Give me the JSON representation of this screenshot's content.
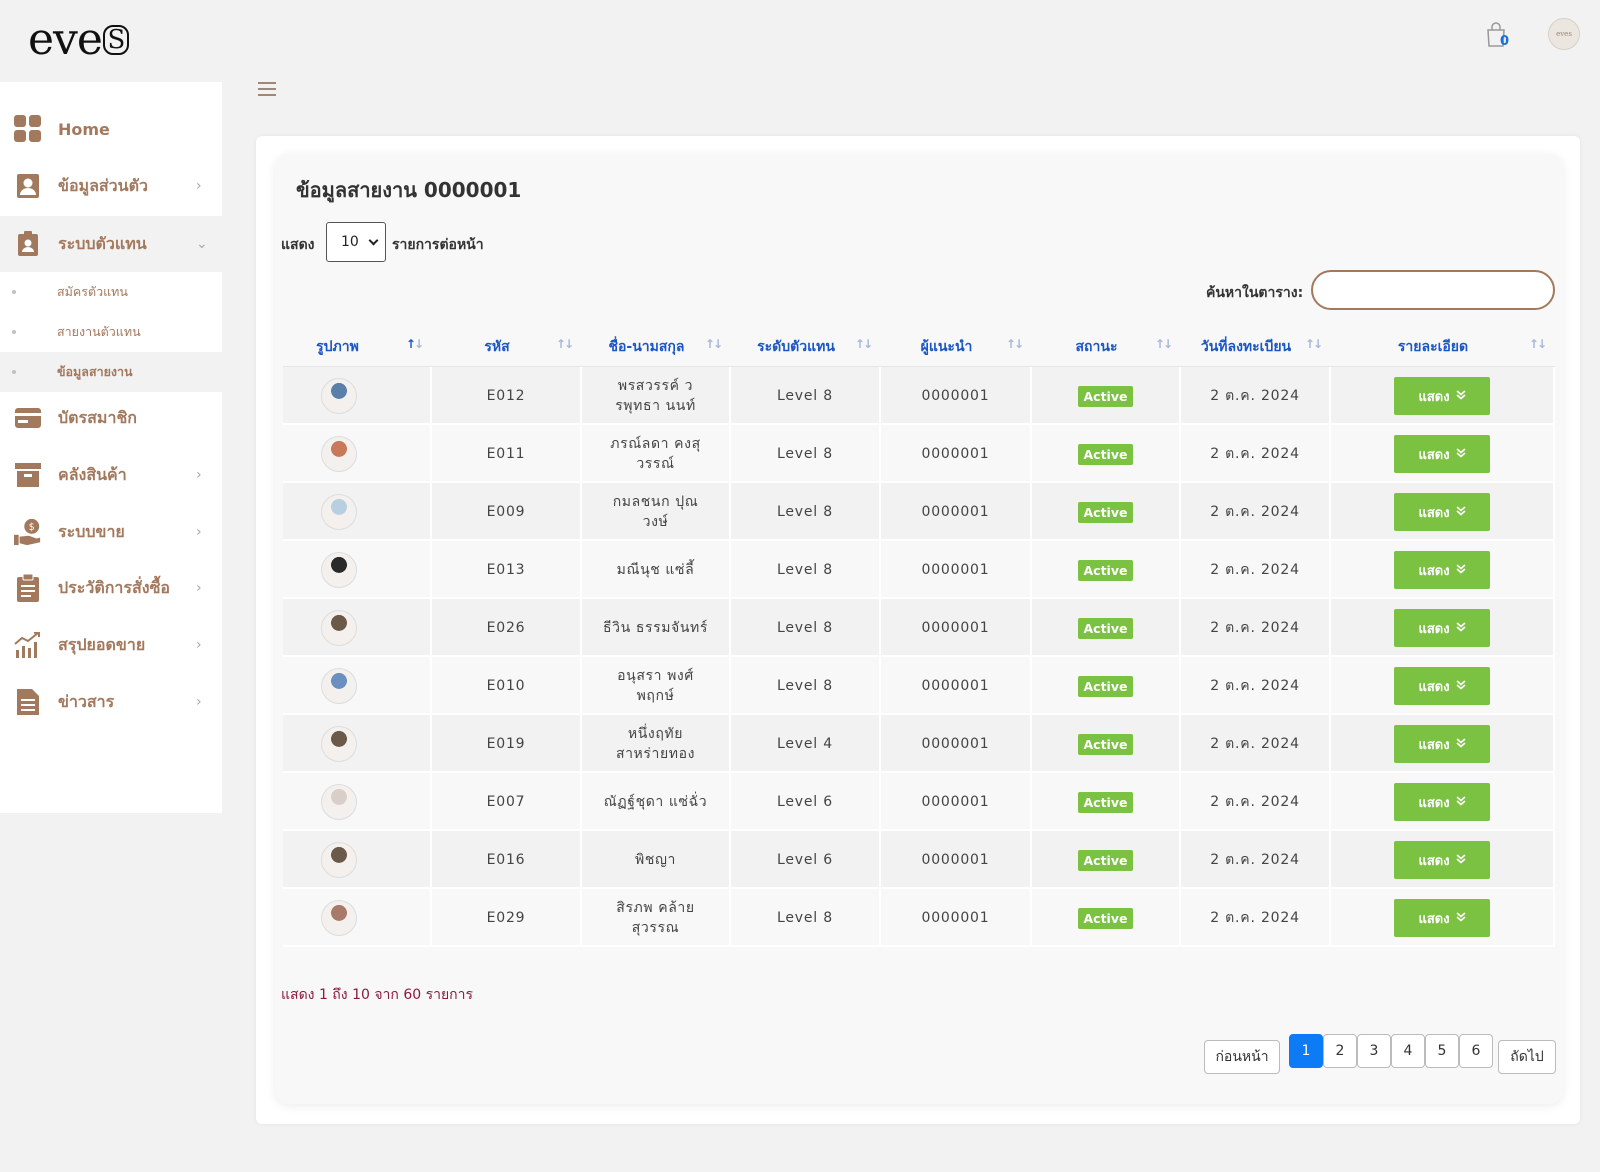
{
  "brand": {
    "logo_text": "eve",
    "logo_s": "S"
  },
  "header": {
    "cart_count": "0",
    "avatar_text": "eves"
  },
  "sidebar": {
    "items": [
      {
        "label": "Home",
        "icon": "grid-icon"
      },
      {
        "label": "ข้อมูลส่วนตัว",
        "icon": "user-icon",
        "chevron": "›"
      },
      {
        "label": "ระบบตัวแทน",
        "icon": "id-badge-icon",
        "chevron": "⌄"
      },
      {
        "label": "บัตรสมาชิก",
        "icon": "card-icon"
      },
      {
        "label": "คลังสินค้า",
        "icon": "warehouse-icon",
        "chevron": "›"
      },
      {
        "label": "ระบบขาย",
        "icon": "sales-icon",
        "chevron": "›"
      },
      {
        "label": "ประวัติการสั่งซื้อ",
        "icon": "clipboard-icon",
        "chevron": "›"
      },
      {
        "label": "สรุปยอดขาย",
        "icon": "chart-icon",
        "chevron": "›"
      },
      {
        "label": "ข่าวสาร",
        "icon": "news-icon",
        "chevron": "›"
      }
    ],
    "sub_items": [
      {
        "label": "สมัครตัวแทน"
      },
      {
        "label": "สายงานตัวแทน"
      },
      {
        "label": "ข้อมูลสายงาน"
      }
    ]
  },
  "main": {
    "title": "ข้อมูลสายงาน 0000001",
    "length_prefix": "แสดง",
    "length_value": "10",
    "length_suffix": "รายการต่อหน้า",
    "search_label": "ค้นหาในตาราง:",
    "search_value": ""
  },
  "table": {
    "columns": [
      "รูปภาพ",
      "รหัส",
      "ชื่อ-นามสกุล",
      "ระดับตัวแทน",
      "ผู้แนะนำ",
      "สถานะ",
      "วันที่ลงทะเบียน",
      "รายละเอียด"
    ],
    "rows": [
      {
        "code": "E012",
        "name": "พรสวรรค์ วรพุทธา นนท์",
        "level": "Level 8",
        "ref": "0000001",
        "status": "Active",
        "date": "2 ต.ค. 2024",
        "action": "แสดง",
        "avatar_color": "#5a7fa8"
      },
      {
        "code": "E011",
        "name": "ภรณ์ลดา คงสุวรรณ์",
        "level": "Level 8",
        "ref": "0000001",
        "status": "Active",
        "date": "2 ต.ค. 2024",
        "action": "แสดง",
        "avatar_color": "#c9795a"
      },
      {
        "code": "E009",
        "name": "กมลชนก ปุณวงษ์",
        "level": "Level 8",
        "ref": "0000001",
        "status": "Active",
        "date": "2 ต.ค. 2024",
        "action": "แสดง",
        "avatar_color": "#b8cfe0"
      },
      {
        "code": "E013",
        "name": "มณีนุช แซ่ลี้",
        "level": "Level 8",
        "ref": "0000001",
        "status": "Active",
        "date": "2 ต.ค. 2024",
        "action": "แสดง",
        "avatar_color": "#2a2a2a"
      },
      {
        "code": "E026",
        "name": "ธีวิน ธรรมจันทร์",
        "level": "Level 8",
        "ref": "0000001",
        "status": "Active",
        "date": "2 ต.ค. 2024",
        "action": "แสดง",
        "avatar_color": "#6b5a4a"
      },
      {
        "code": "E010",
        "name": "อนุสรา พงศ์พฤกษ์",
        "level": "Level 8",
        "ref": "0000001",
        "status": "Active",
        "date": "2 ต.ค. 2024",
        "action": "แสดง",
        "avatar_color": "#6a8fc0"
      },
      {
        "code": "E019",
        "name": "หนึ่งฤทัย สาหร่ายทอง",
        "level": "Level 4",
        "ref": "0000001",
        "status": "Active",
        "date": "2 ต.ค. 2024",
        "action": "แสดง",
        "avatar_color": "#6b5a4a"
      },
      {
        "code": "E007",
        "name": "ณัฏฐ์ชุดา แซ่ฉั่ว",
        "level": "Level 6",
        "ref": "0000001",
        "status": "Active",
        "date": "2 ต.ค. 2024",
        "action": "แสดง",
        "avatar_color": "#d9cfc8"
      },
      {
        "code": "E016",
        "name": "พิชญา",
        "level": "Level 6",
        "ref": "0000001",
        "status": "Active",
        "date": "2 ต.ค. 2024",
        "action": "แสดง",
        "avatar_color": "#6b5a4a"
      },
      {
        "code": "E029",
        "name": "สิรภพ คล้ายสุวรรณ",
        "level": "Level 8",
        "ref": "0000001",
        "status": "Active",
        "date": "2 ต.ค. 2024",
        "action": "แสดง",
        "avatar_color": "#a87a6a"
      }
    ]
  },
  "footer": {
    "info": "แสดง 1 ถึง 10 จาก 60 รายการ",
    "prev": "ก่อนหน้า",
    "next": "ถัดไป",
    "pages": [
      "1",
      "2",
      "3",
      "4",
      "5",
      "6"
    ],
    "current_page": "1"
  },
  "colors": {
    "accent": "#a3795e",
    "header_blue": "#1a56c4",
    "active_green": "#7bc142",
    "page_blue": "#0d7bf5",
    "info_red": "#8b1a3d"
  }
}
